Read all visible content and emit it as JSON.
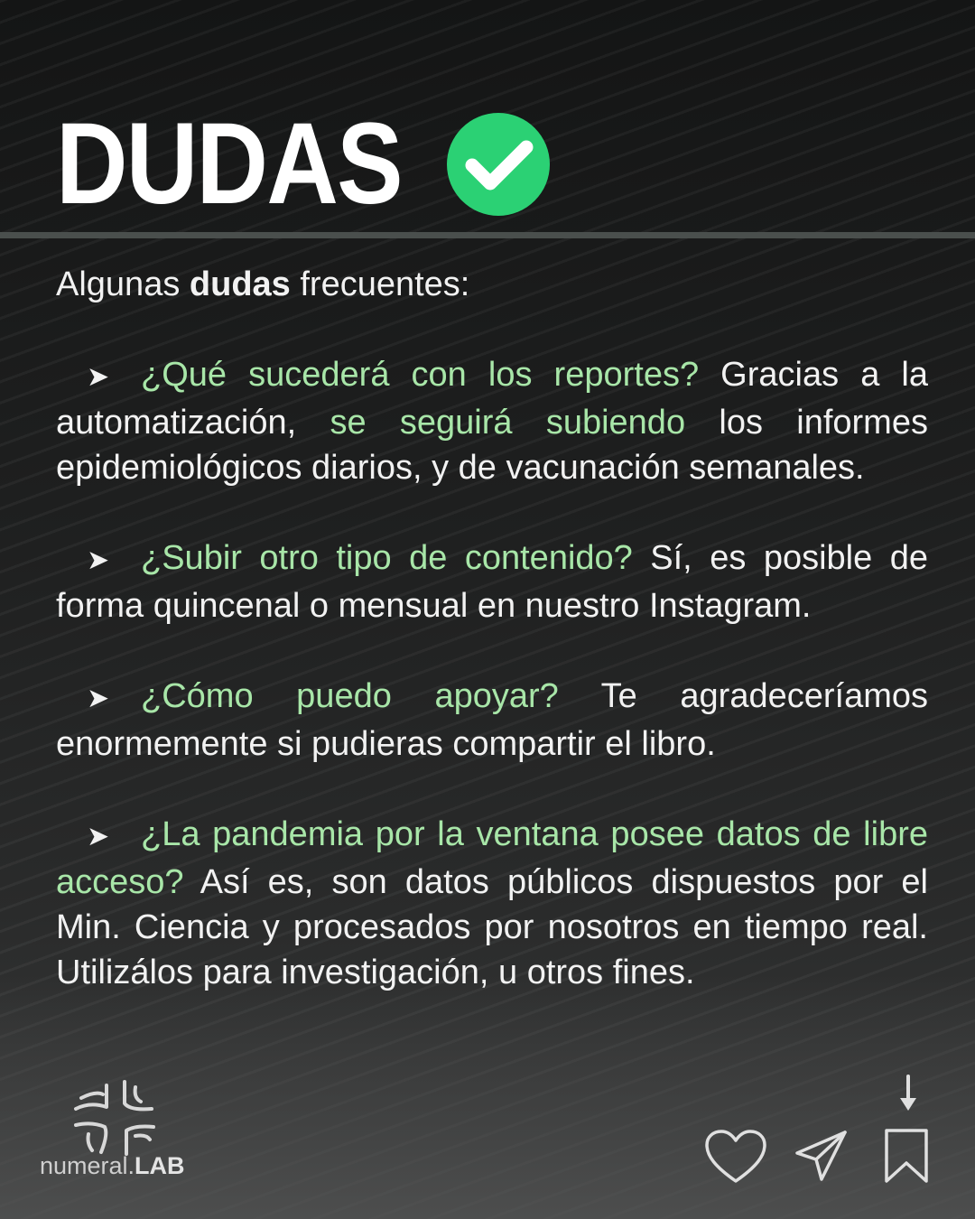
{
  "header": {
    "title": "DUDAS",
    "check_color": "#2bd174"
  },
  "content": {
    "intro_prefix": "Algunas ",
    "intro_bold": "dudas",
    "intro_suffix": " frecuentes:",
    "bullet_glyph": "➤",
    "items": [
      {
        "question": "¿Qué sucederá con los reportes?",
        "answer_a": " Gracias a la automatización, ",
        "highlight": "se seguirá subiendo",
        "answer_b": " los informes epidemiológicos diarios, y de vacunación semanales."
      },
      {
        "question": "¿Subir otro tipo de contenido?",
        "answer_a": " Sí, es posible de forma quincenal o mensual en nuestro Instagram."
      },
      {
        "question": "¿Cómo puedo apoyar?",
        "answer_a": " Te agradeceríamos enormemente si pudieras compartir el libro."
      },
      {
        "question": "¿La pandemia por la ventana posee datos de libre acceso?",
        "answer_a": " Así es, son datos públicos dispuestos por el Min. Ciencia y procesados por nosotros en tiempo real. Utilizálos para investigación, u otros fines."
      }
    ]
  },
  "branding": {
    "logo_text_light": "numeral.",
    "logo_text_bold": "LAB"
  },
  "actions": {
    "icons": [
      "heart-icon",
      "send-icon",
      "bookmark-icon",
      "arrow-down-icon"
    ]
  },
  "colors": {
    "accent": "#a8e6a8",
    "background": "#1a1b1b",
    "divider": "#4a4f4d"
  }
}
